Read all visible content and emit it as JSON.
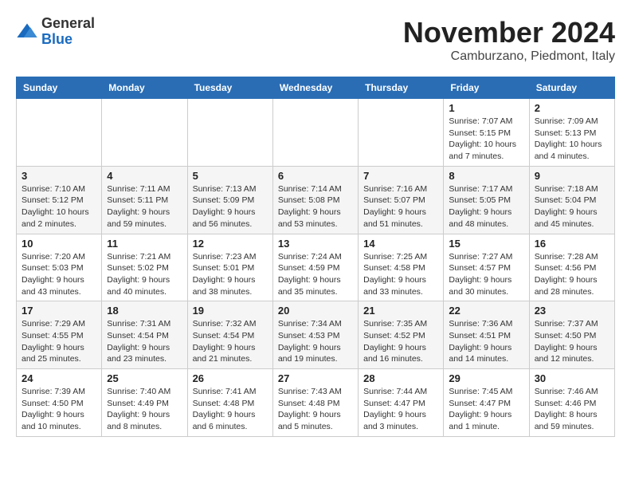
{
  "header": {
    "logo_line1": "General",
    "logo_line2": "Blue",
    "month": "November 2024",
    "location": "Camburzano, Piedmont, Italy"
  },
  "weekdays": [
    "Sunday",
    "Monday",
    "Tuesday",
    "Wednesday",
    "Thursday",
    "Friday",
    "Saturday"
  ],
  "weeks": [
    [
      {
        "day": "",
        "info": ""
      },
      {
        "day": "",
        "info": ""
      },
      {
        "day": "",
        "info": ""
      },
      {
        "day": "",
        "info": ""
      },
      {
        "day": "",
        "info": ""
      },
      {
        "day": "1",
        "info": "Sunrise: 7:07 AM\nSunset: 5:15 PM\nDaylight: 10 hours and 7 minutes."
      },
      {
        "day": "2",
        "info": "Sunrise: 7:09 AM\nSunset: 5:13 PM\nDaylight: 10 hours and 4 minutes."
      }
    ],
    [
      {
        "day": "3",
        "info": "Sunrise: 7:10 AM\nSunset: 5:12 PM\nDaylight: 10 hours and 2 minutes."
      },
      {
        "day": "4",
        "info": "Sunrise: 7:11 AM\nSunset: 5:11 PM\nDaylight: 9 hours and 59 minutes."
      },
      {
        "day": "5",
        "info": "Sunrise: 7:13 AM\nSunset: 5:09 PM\nDaylight: 9 hours and 56 minutes."
      },
      {
        "day": "6",
        "info": "Sunrise: 7:14 AM\nSunset: 5:08 PM\nDaylight: 9 hours and 53 minutes."
      },
      {
        "day": "7",
        "info": "Sunrise: 7:16 AM\nSunset: 5:07 PM\nDaylight: 9 hours and 51 minutes."
      },
      {
        "day": "8",
        "info": "Sunrise: 7:17 AM\nSunset: 5:05 PM\nDaylight: 9 hours and 48 minutes."
      },
      {
        "day": "9",
        "info": "Sunrise: 7:18 AM\nSunset: 5:04 PM\nDaylight: 9 hours and 45 minutes."
      }
    ],
    [
      {
        "day": "10",
        "info": "Sunrise: 7:20 AM\nSunset: 5:03 PM\nDaylight: 9 hours and 43 minutes."
      },
      {
        "day": "11",
        "info": "Sunrise: 7:21 AM\nSunset: 5:02 PM\nDaylight: 9 hours and 40 minutes."
      },
      {
        "day": "12",
        "info": "Sunrise: 7:23 AM\nSunset: 5:01 PM\nDaylight: 9 hours and 38 minutes."
      },
      {
        "day": "13",
        "info": "Sunrise: 7:24 AM\nSunset: 4:59 PM\nDaylight: 9 hours and 35 minutes."
      },
      {
        "day": "14",
        "info": "Sunrise: 7:25 AM\nSunset: 4:58 PM\nDaylight: 9 hours and 33 minutes."
      },
      {
        "day": "15",
        "info": "Sunrise: 7:27 AM\nSunset: 4:57 PM\nDaylight: 9 hours and 30 minutes."
      },
      {
        "day": "16",
        "info": "Sunrise: 7:28 AM\nSunset: 4:56 PM\nDaylight: 9 hours and 28 minutes."
      }
    ],
    [
      {
        "day": "17",
        "info": "Sunrise: 7:29 AM\nSunset: 4:55 PM\nDaylight: 9 hours and 25 minutes."
      },
      {
        "day": "18",
        "info": "Sunrise: 7:31 AM\nSunset: 4:54 PM\nDaylight: 9 hours and 23 minutes."
      },
      {
        "day": "19",
        "info": "Sunrise: 7:32 AM\nSunset: 4:54 PM\nDaylight: 9 hours and 21 minutes."
      },
      {
        "day": "20",
        "info": "Sunrise: 7:34 AM\nSunset: 4:53 PM\nDaylight: 9 hours and 19 minutes."
      },
      {
        "day": "21",
        "info": "Sunrise: 7:35 AM\nSunset: 4:52 PM\nDaylight: 9 hours and 16 minutes."
      },
      {
        "day": "22",
        "info": "Sunrise: 7:36 AM\nSunset: 4:51 PM\nDaylight: 9 hours and 14 minutes."
      },
      {
        "day": "23",
        "info": "Sunrise: 7:37 AM\nSunset: 4:50 PM\nDaylight: 9 hours and 12 minutes."
      }
    ],
    [
      {
        "day": "24",
        "info": "Sunrise: 7:39 AM\nSunset: 4:50 PM\nDaylight: 9 hours and 10 minutes."
      },
      {
        "day": "25",
        "info": "Sunrise: 7:40 AM\nSunset: 4:49 PM\nDaylight: 9 hours and 8 minutes."
      },
      {
        "day": "26",
        "info": "Sunrise: 7:41 AM\nSunset: 4:48 PM\nDaylight: 9 hours and 6 minutes."
      },
      {
        "day": "27",
        "info": "Sunrise: 7:43 AM\nSunset: 4:48 PM\nDaylight: 9 hours and 5 minutes."
      },
      {
        "day": "28",
        "info": "Sunrise: 7:44 AM\nSunset: 4:47 PM\nDaylight: 9 hours and 3 minutes."
      },
      {
        "day": "29",
        "info": "Sunrise: 7:45 AM\nSunset: 4:47 PM\nDaylight: 9 hours and 1 minute."
      },
      {
        "day": "30",
        "info": "Sunrise: 7:46 AM\nSunset: 4:46 PM\nDaylight: 8 hours and 59 minutes."
      }
    ]
  ]
}
